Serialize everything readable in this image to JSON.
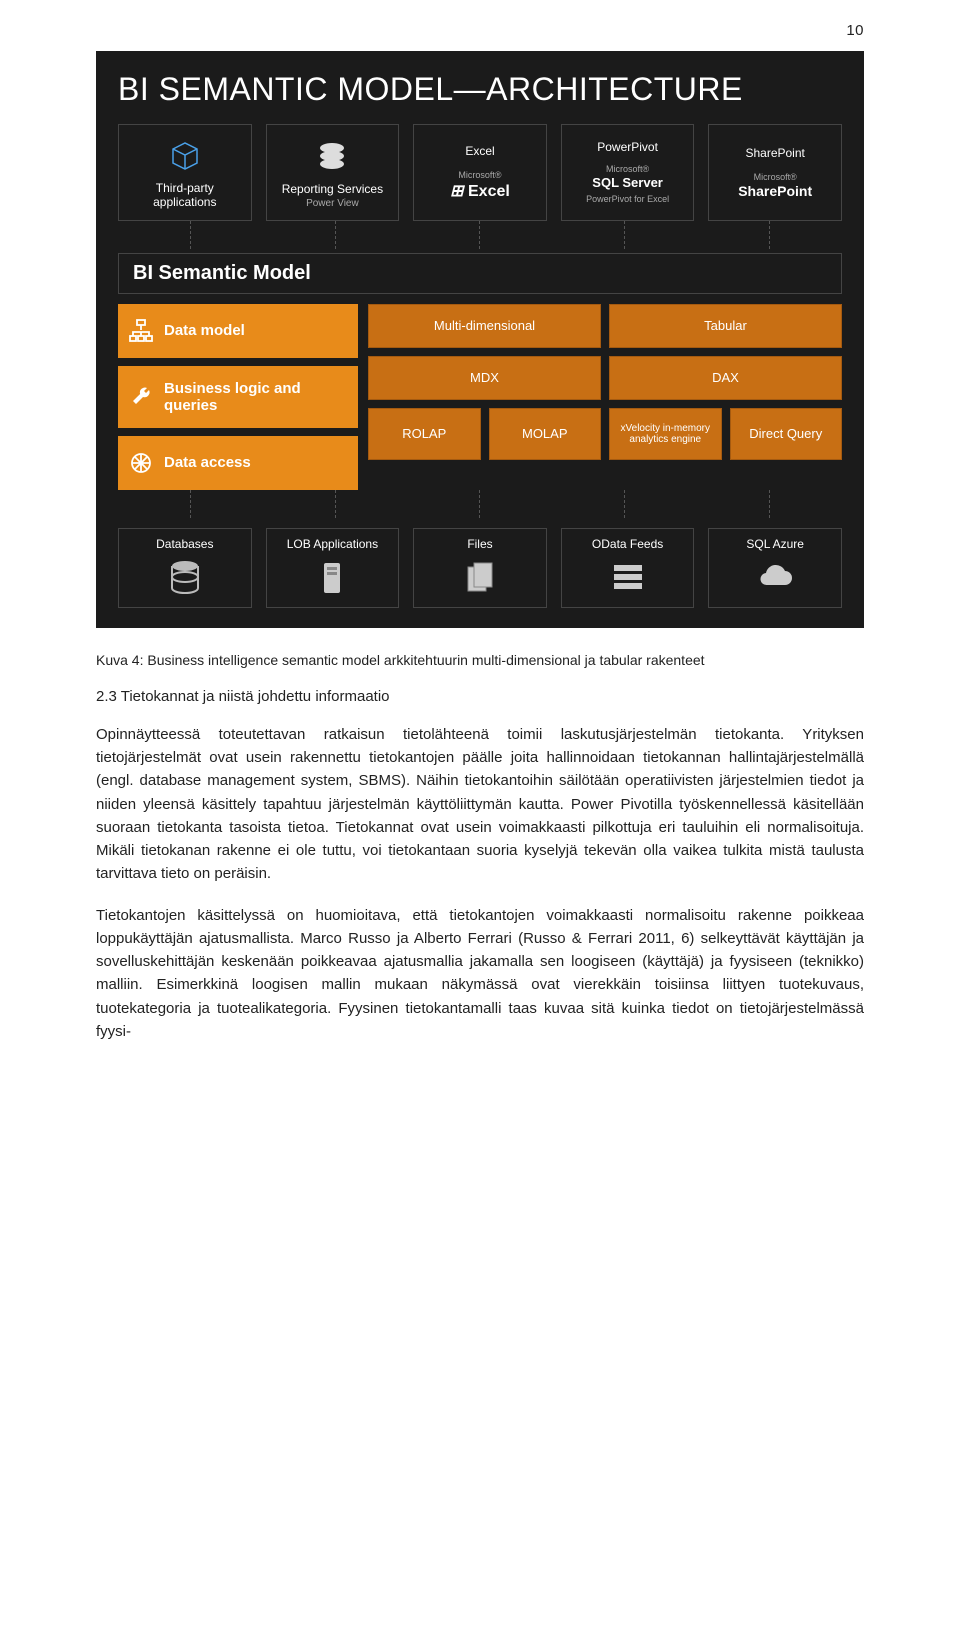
{
  "page_number": "10",
  "diagram": {
    "title_pre": "BI SEMANTIC MODEL",
    "title_dash": "—",
    "title_post": "ARCHITECTURE",
    "top": [
      {
        "label": "Third-party applications"
      },
      {
        "label": "Reporting Services",
        "sub": "Power View"
      },
      {
        "label": "Excel",
        "brand_small": "Microsoft®",
        "brand": "Excel"
      },
      {
        "label": "PowerPivot",
        "brand_small": "Microsoft®",
        "brand": "SQL Server",
        "brand_sub": "PowerPivot for Excel"
      },
      {
        "label": "SharePoint",
        "brand_small": "Microsoft®",
        "brand": "SharePoint"
      }
    ],
    "bism_title": "BI Semantic Model",
    "left_rows": [
      "Data model",
      "Business logic and queries",
      "Data access"
    ],
    "right_rows": [
      [
        "Multi-dimensional",
        "Tabular"
      ],
      [
        "MDX",
        "DAX"
      ],
      [
        "ROLAP",
        "MOLAP",
        "xVelocity in-memory analytics engine",
        "Direct Query"
      ]
    ],
    "bottom": [
      "Databases",
      "LOB Applications",
      "Files",
      "OData Feeds",
      "SQL Azure"
    ]
  },
  "caption": "Kuva 4: Business intelligence semantic model arkkitehtuurin multi-dimensional ja tabular rakenteet",
  "section_heading": "2.3   Tietokannat ja niistä johdettu informaatio",
  "paragraphs": [
    "Opinnäytteessä toteutettavan ratkaisun tietolähteenä toimii laskutusjärjestelmän tietokanta. Yrityksen tietojärjestelmät ovat usein rakennettu tietokantojen päälle joita hallinnoidaan tietokannan hallintajärjestelmällä (engl. database management system, SBMS). Näihin tietokantoihin säilötään operatiivisten järjestelmien tiedot ja niiden yleensä käsittely tapahtuu järjestelmän käyttöliittymän kautta. Power Pivotilla työskennellessä käsitellään suoraan tietokanta tasoista tietoa. Tietokannat ovat usein voimakkaasti pilkottuja eri tauluihin eli normalisoituja. Mikäli tietokanan rakenne ei ole tuttu, voi tietokantaan suoria kyselyjä tekevän olla vaikea tulkita mistä taulusta tarvittava tieto on peräisin.",
    "Tietokantojen käsittelyssä on huomioitava, että tietokantojen voimakkaasti normalisoitu rakenne poikkeaa loppukäyttäjän ajatusmallista. Marco Russo ja Alberto Ferrari (Russo & Ferrari 2011, 6) selkeyttävät käyttäjän ja sovelluskehittäjän keskenään poikkeavaa ajatusmallia jakamalla sen loogiseen (käyttäjä) ja fyysiseen (teknikko) malliin. Esimerkkinä loogisen mallin mukaan näkymässä ovat vierekkäin toisiinsa liittyen tuotekuvaus, tuotekategoria ja tuotealikategoria. Fyysinen tietokantamalli taas kuvaa sitä kuinka tiedot on tietojärjestelmässä fyysi-"
  ]
}
